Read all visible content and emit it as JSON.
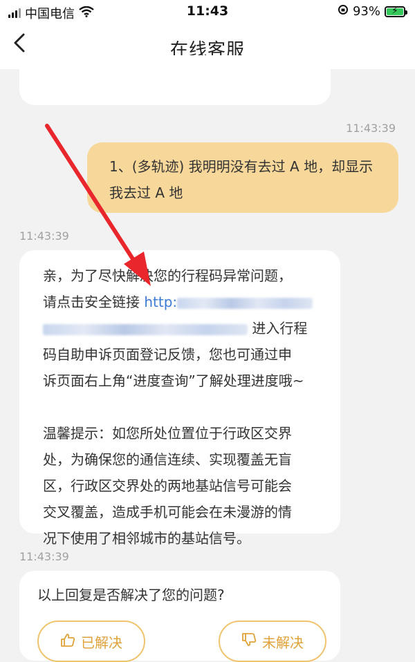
{
  "status_bar": {
    "carrier": "中国电信",
    "time": "11:43",
    "battery_percent": "93%"
  },
  "nav": {
    "title": "在线客服"
  },
  "messages": {
    "user_time": "11:43:39",
    "user_text_line1": "1、(多轨迹) 我明明没有去过 A 地，却显示",
    "user_text_line2": "我去过 A 地",
    "bot_time": "11:43:39",
    "bot_line1": "亲，为了尽快解决您的行程码异常问题，",
    "bot_line2_prefix": "请点击安全链接 ",
    "bot_link_prefix": "http:",
    "bot_line3_suffix": " 进入行程",
    "bot_line4": "码自助申诉页面登记反馈，您也可通过申",
    "bot_line5": "诉页面右上角“进度查询”了解处理进度哦~",
    "tip_line1": "温馨提示：如您所处位置位于行政区交界",
    "tip_line2": "处，为确保您的通信连续、实现覆盖无盲",
    "tip_line3": "区，行政区交界处的两地基站信号可能会",
    "tip_line4": "交叉覆盖，造成手机可能会在未漫游的情",
    "tip_line5": "况下使用了相邻城市的基站信号。",
    "survey_time": "11:43:39",
    "survey_question": "以上回复是否解决了您的问题?",
    "solved_label": "已解决",
    "unsolved_label": "未解决"
  },
  "colors": {
    "annotation_arrow": "#e8262b",
    "user_bubble": "#f8d89a",
    "link": "#3c7bd4"
  }
}
